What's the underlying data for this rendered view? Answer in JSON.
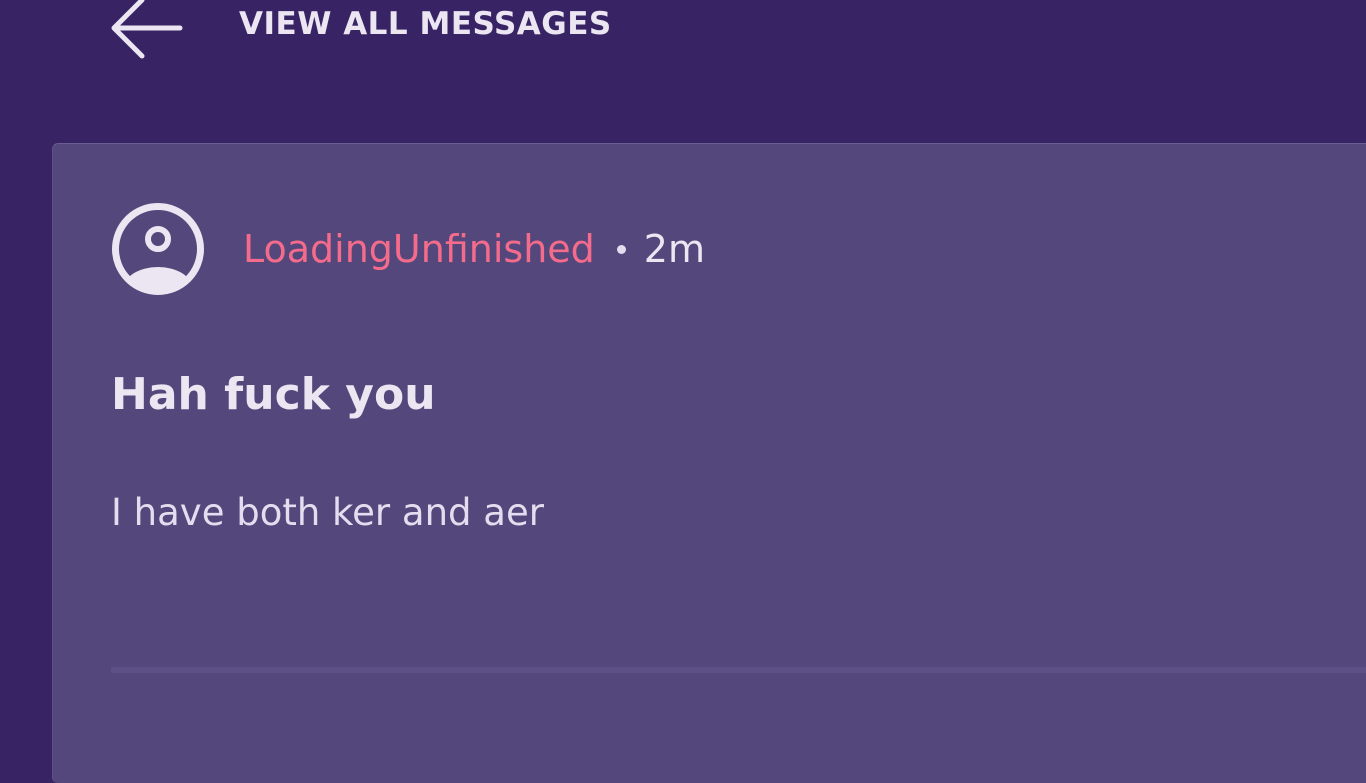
{
  "header": {
    "back_icon": "arrow-left-icon",
    "title": "VIEW ALL MESSAGES"
  },
  "message": {
    "avatar_icon": "user-circle-icon",
    "author": "LoadingUnfinished",
    "separator": "•",
    "timestamp": "2m",
    "title": "Hah fuck you",
    "body": "I have both ker and aer"
  },
  "colors": {
    "background": "#382464",
    "card": "#54477b",
    "author": "#f46b8b",
    "text": "#ece6f2"
  }
}
